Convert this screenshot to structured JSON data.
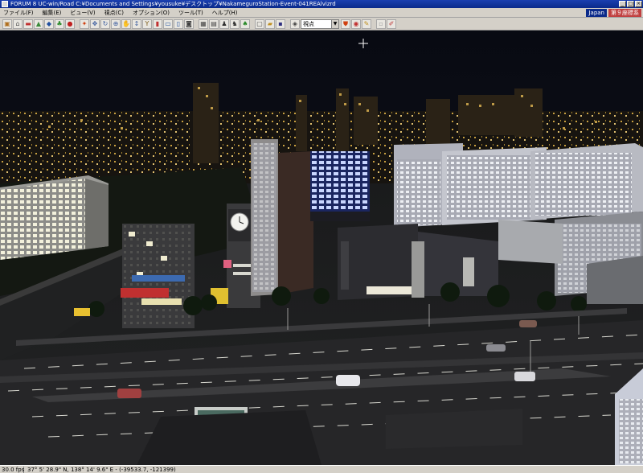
{
  "window": {
    "title": "FORUM 8    UC-win/Road    C:¥Documents and Settings¥yousuke¥デスクトップ¥NakameguroStation-Event-041REAlvizrd"
  },
  "menu": {
    "items": [
      "ファイル(F)",
      "編集(E)",
      "ビュー(V)",
      "視点(C)",
      "オプション(O)",
      "ツール(T)",
      "ヘルプ(H)"
    ],
    "language": "Japan",
    "mode": "第９座標系"
  },
  "toolbar": {
    "view_select_value": "視点"
  },
  "status": {
    "fps": "30.0 fps",
    "coordinates": "37°  5' 28.9\" N, 138°  14' 9.6\" E  -  (-39533.7, -121399)"
  },
  "scene": {
    "sky_color": "#0b0d14",
    "road_color": "#2a2a2e",
    "lit_window_color": "#f2f0d8",
    "blue_lit_color": "#8fb2ff"
  }
}
